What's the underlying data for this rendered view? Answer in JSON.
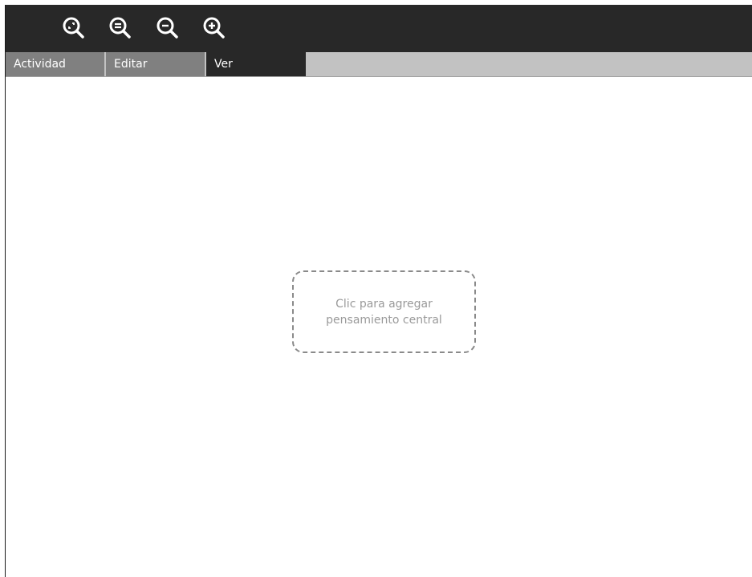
{
  "toolbar": {
    "buttons": [
      {
        "icon": "zoom-original-icon"
      },
      {
        "icon": "zoom-fit-icon"
      },
      {
        "icon": "zoom-out-icon"
      },
      {
        "icon": "zoom-in-icon"
      }
    ],
    "background": "#282828",
    "icon_color": "#ffffff"
  },
  "tabs": [
    {
      "label": "Actividad",
      "active": false
    },
    {
      "label": "Editar",
      "active": false
    },
    {
      "label": "Ver",
      "active": true
    }
  ],
  "canvas": {
    "central_thought": {
      "line1": "Clic para agregar",
      "line2": "pensamiento central",
      "border_color": "#8a8a8a",
      "text_color": "#9a9a9a"
    }
  }
}
